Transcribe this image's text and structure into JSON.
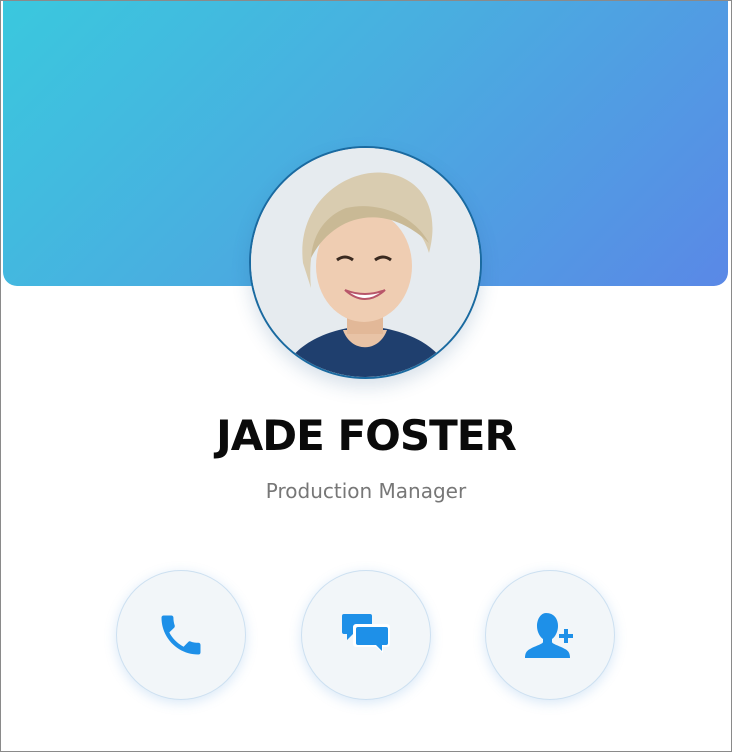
{
  "profile": {
    "name": "JADE FOSTER",
    "role": "Production Manager"
  },
  "actions": [
    {
      "id": "call",
      "icon": "phone-icon"
    },
    {
      "id": "message",
      "icon": "chat-bubbles-icon"
    },
    {
      "id": "add-contact",
      "icon": "add-user-icon"
    }
  ],
  "colors": {
    "banner_start": "#3ac8de",
    "banner_end": "#5a88e6",
    "icon_blue": "#1e90e8",
    "avatar_border": "#1a6aa0"
  }
}
